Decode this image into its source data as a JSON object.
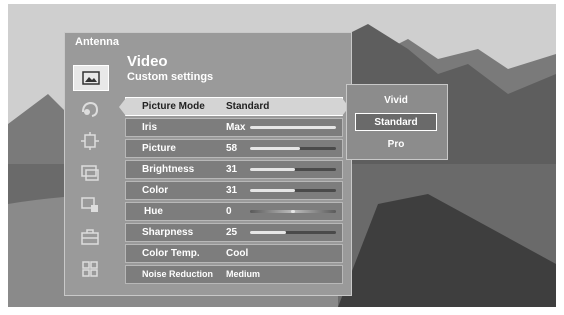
{
  "source": "Antenna",
  "header": {
    "title": "Video",
    "subtitle": "Custom settings"
  },
  "sidebar": [
    {
      "icon": "picture-icon",
      "active": true
    },
    {
      "icon": "audio-icon",
      "active": false
    },
    {
      "icon": "screen-icon",
      "active": false
    },
    {
      "icon": "display-icon",
      "active": false
    },
    {
      "icon": "lock-icon",
      "active": false
    },
    {
      "icon": "toolbox-icon",
      "active": false
    },
    {
      "icon": "apps-icon",
      "active": false
    }
  ],
  "settings": [
    {
      "label": "Picture Mode",
      "value": "Standard",
      "selected": true
    },
    {
      "label": "Iris",
      "value": "Max",
      "level": 1.0
    },
    {
      "label": "Picture",
      "value": "58",
      "level": 0.58
    },
    {
      "label": "Brightness",
      "value": "31",
      "level": 0.52
    },
    {
      "label": "Color",
      "value": "31",
      "level": 0.52
    },
    {
      "label": "Hue",
      "value": "0",
      "level": 0.5,
      "center": true
    },
    {
      "label": "Sharpness",
      "value": "25",
      "level": 0.42
    },
    {
      "label": "Color Temp.",
      "value": "Cool"
    },
    {
      "label": "Noise Reduction",
      "value": "Medium"
    }
  ],
  "dropdown": [
    {
      "label": "Vivid",
      "selected": false
    },
    {
      "label": "Standard",
      "selected": true
    },
    {
      "label": "Pro",
      "selected": false
    }
  ]
}
